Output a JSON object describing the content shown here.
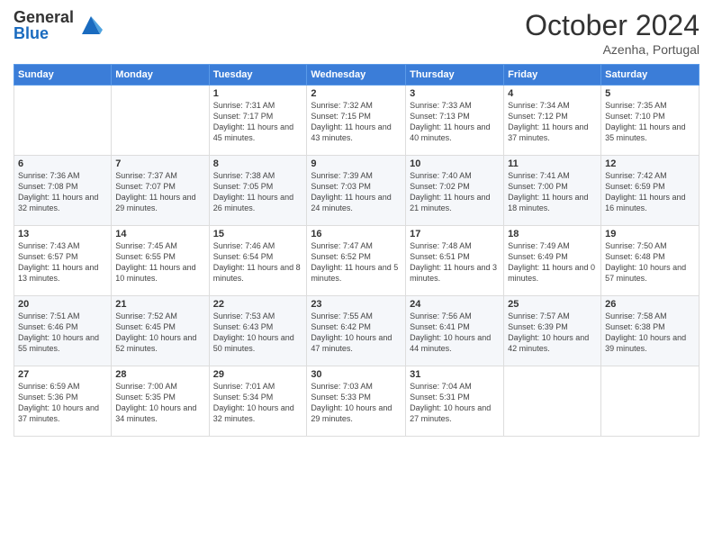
{
  "header": {
    "logo_general": "General",
    "logo_blue": "Blue",
    "month_title": "October 2024",
    "subtitle": "Azenha, Portugal"
  },
  "days_of_week": [
    "Sunday",
    "Monday",
    "Tuesday",
    "Wednesday",
    "Thursday",
    "Friday",
    "Saturday"
  ],
  "weeks": [
    [
      {
        "day": "",
        "sunrise": "",
        "sunset": "",
        "daylight": ""
      },
      {
        "day": "",
        "sunrise": "",
        "sunset": "",
        "daylight": ""
      },
      {
        "day": "1",
        "sunrise": "Sunrise: 7:31 AM",
        "sunset": "Sunset: 7:17 PM",
        "daylight": "Daylight: 11 hours and 45 minutes."
      },
      {
        "day": "2",
        "sunrise": "Sunrise: 7:32 AM",
        "sunset": "Sunset: 7:15 PM",
        "daylight": "Daylight: 11 hours and 43 minutes."
      },
      {
        "day": "3",
        "sunrise": "Sunrise: 7:33 AM",
        "sunset": "Sunset: 7:13 PM",
        "daylight": "Daylight: 11 hours and 40 minutes."
      },
      {
        "day": "4",
        "sunrise": "Sunrise: 7:34 AM",
        "sunset": "Sunset: 7:12 PM",
        "daylight": "Daylight: 11 hours and 37 minutes."
      },
      {
        "day": "5",
        "sunrise": "Sunrise: 7:35 AM",
        "sunset": "Sunset: 7:10 PM",
        "daylight": "Daylight: 11 hours and 35 minutes."
      }
    ],
    [
      {
        "day": "6",
        "sunrise": "Sunrise: 7:36 AM",
        "sunset": "Sunset: 7:08 PM",
        "daylight": "Daylight: 11 hours and 32 minutes."
      },
      {
        "day": "7",
        "sunrise": "Sunrise: 7:37 AM",
        "sunset": "Sunset: 7:07 PM",
        "daylight": "Daylight: 11 hours and 29 minutes."
      },
      {
        "day": "8",
        "sunrise": "Sunrise: 7:38 AM",
        "sunset": "Sunset: 7:05 PM",
        "daylight": "Daylight: 11 hours and 26 minutes."
      },
      {
        "day": "9",
        "sunrise": "Sunrise: 7:39 AM",
        "sunset": "Sunset: 7:03 PM",
        "daylight": "Daylight: 11 hours and 24 minutes."
      },
      {
        "day": "10",
        "sunrise": "Sunrise: 7:40 AM",
        "sunset": "Sunset: 7:02 PM",
        "daylight": "Daylight: 11 hours and 21 minutes."
      },
      {
        "day": "11",
        "sunrise": "Sunrise: 7:41 AM",
        "sunset": "Sunset: 7:00 PM",
        "daylight": "Daylight: 11 hours and 18 minutes."
      },
      {
        "day": "12",
        "sunrise": "Sunrise: 7:42 AM",
        "sunset": "Sunset: 6:59 PM",
        "daylight": "Daylight: 11 hours and 16 minutes."
      }
    ],
    [
      {
        "day": "13",
        "sunrise": "Sunrise: 7:43 AM",
        "sunset": "Sunset: 6:57 PM",
        "daylight": "Daylight: 11 hours and 13 minutes."
      },
      {
        "day": "14",
        "sunrise": "Sunrise: 7:45 AM",
        "sunset": "Sunset: 6:55 PM",
        "daylight": "Daylight: 11 hours and 10 minutes."
      },
      {
        "day": "15",
        "sunrise": "Sunrise: 7:46 AM",
        "sunset": "Sunset: 6:54 PM",
        "daylight": "Daylight: 11 hours and 8 minutes."
      },
      {
        "day": "16",
        "sunrise": "Sunrise: 7:47 AM",
        "sunset": "Sunset: 6:52 PM",
        "daylight": "Daylight: 11 hours and 5 minutes."
      },
      {
        "day": "17",
        "sunrise": "Sunrise: 7:48 AM",
        "sunset": "Sunset: 6:51 PM",
        "daylight": "Daylight: 11 hours and 3 minutes."
      },
      {
        "day": "18",
        "sunrise": "Sunrise: 7:49 AM",
        "sunset": "Sunset: 6:49 PM",
        "daylight": "Daylight: 11 hours and 0 minutes."
      },
      {
        "day": "19",
        "sunrise": "Sunrise: 7:50 AM",
        "sunset": "Sunset: 6:48 PM",
        "daylight": "Daylight: 10 hours and 57 minutes."
      }
    ],
    [
      {
        "day": "20",
        "sunrise": "Sunrise: 7:51 AM",
        "sunset": "Sunset: 6:46 PM",
        "daylight": "Daylight: 10 hours and 55 minutes."
      },
      {
        "day": "21",
        "sunrise": "Sunrise: 7:52 AM",
        "sunset": "Sunset: 6:45 PM",
        "daylight": "Daylight: 10 hours and 52 minutes."
      },
      {
        "day": "22",
        "sunrise": "Sunrise: 7:53 AM",
        "sunset": "Sunset: 6:43 PM",
        "daylight": "Daylight: 10 hours and 50 minutes."
      },
      {
        "day": "23",
        "sunrise": "Sunrise: 7:55 AM",
        "sunset": "Sunset: 6:42 PM",
        "daylight": "Daylight: 10 hours and 47 minutes."
      },
      {
        "day": "24",
        "sunrise": "Sunrise: 7:56 AM",
        "sunset": "Sunset: 6:41 PM",
        "daylight": "Daylight: 10 hours and 44 minutes."
      },
      {
        "day": "25",
        "sunrise": "Sunrise: 7:57 AM",
        "sunset": "Sunset: 6:39 PM",
        "daylight": "Daylight: 10 hours and 42 minutes."
      },
      {
        "day": "26",
        "sunrise": "Sunrise: 7:58 AM",
        "sunset": "Sunset: 6:38 PM",
        "daylight": "Daylight: 10 hours and 39 minutes."
      }
    ],
    [
      {
        "day": "27",
        "sunrise": "Sunrise: 6:59 AM",
        "sunset": "Sunset: 5:36 PM",
        "daylight": "Daylight: 10 hours and 37 minutes."
      },
      {
        "day": "28",
        "sunrise": "Sunrise: 7:00 AM",
        "sunset": "Sunset: 5:35 PM",
        "daylight": "Daylight: 10 hours and 34 minutes."
      },
      {
        "day": "29",
        "sunrise": "Sunrise: 7:01 AM",
        "sunset": "Sunset: 5:34 PM",
        "daylight": "Daylight: 10 hours and 32 minutes."
      },
      {
        "day": "30",
        "sunrise": "Sunrise: 7:03 AM",
        "sunset": "Sunset: 5:33 PM",
        "daylight": "Daylight: 10 hours and 29 minutes."
      },
      {
        "day": "31",
        "sunrise": "Sunrise: 7:04 AM",
        "sunset": "Sunset: 5:31 PM",
        "daylight": "Daylight: 10 hours and 27 minutes."
      },
      {
        "day": "",
        "sunrise": "",
        "sunset": "",
        "daylight": ""
      },
      {
        "day": "",
        "sunrise": "",
        "sunset": "",
        "daylight": ""
      }
    ]
  ]
}
